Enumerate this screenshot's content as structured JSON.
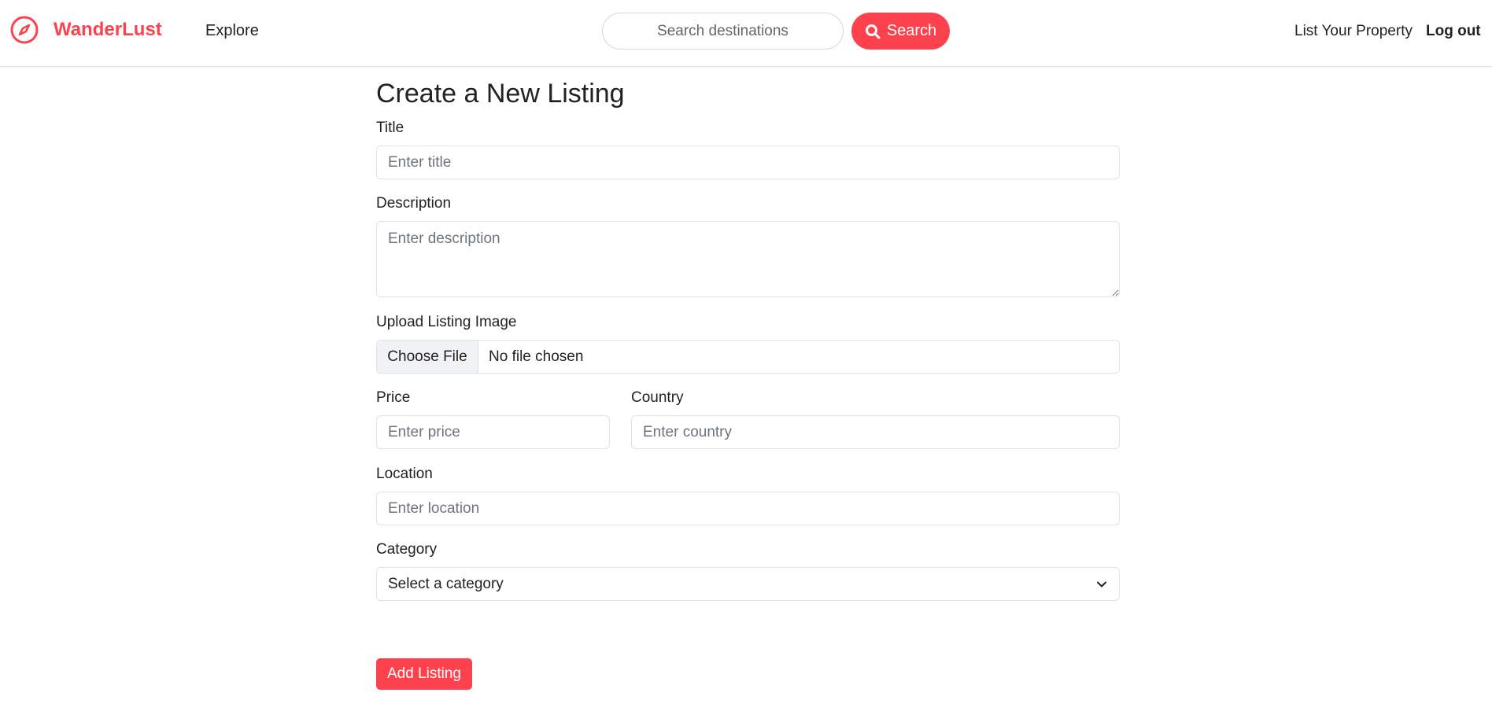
{
  "brand": {
    "name": "WanderLust",
    "accent": "#fe424d",
    "icon": "compass-icon"
  },
  "nav": {
    "explore": "Explore",
    "search_placeholder": "Search destinations",
    "search_button": "Search",
    "list_property": "List Your Property",
    "logout": "Log out"
  },
  "form": {
    "title": "Create a New Listing",
    "title_label": "Title",
    "title_placeholder": "Enter title",
    "description_label": "Description",
    "description_placeholder": "Enter description",
    "image_label": "Upload Listing Image",
    "file_button": "Choose File",
    "file_status": "No file chosen",
    "price_label": "Price",
    "price_placeholder": "Enter price",
    "country_label": "Country",
    "country_placeholder": "Enter country",
    "location_label": "Location",
    "location_placeholder": "Enter location",
    "category_label": "Category",
    "category_selected": "Select a category",
    "submit": "Add Listing"
  }
}
